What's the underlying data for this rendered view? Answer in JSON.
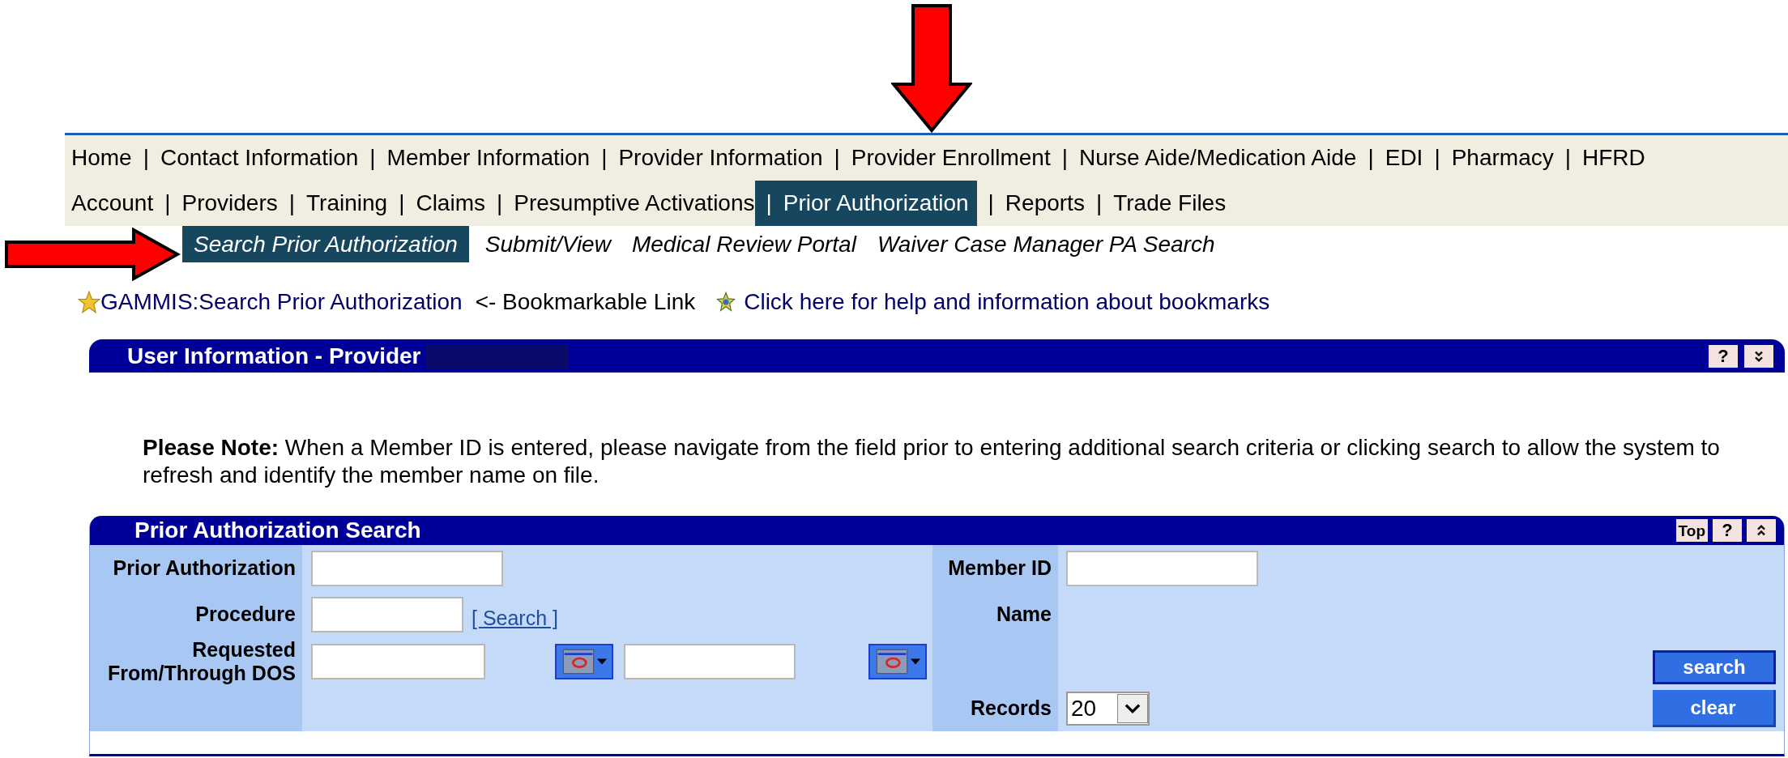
{
  "nav": {
    "items": [
      {
        "label": "Home",
        "selected": false
      },
      {
        "label": "Contact Information",
        "separator": "|",
        "selected": false
      },
      {
        "label": "Member Information",
        "separator": "|",
        "selected": false
      },
      {
        "label": "Provider Information",
        "separator": "|",
        "selected": false
      },
      {
        "label": "Provider Enrollment",
        "separator": "|",
        "selected": false
      },
      {
        "label": "Nurse Aide/Medication Aide",
        "separator": "|",
        "selected": false
      },
      {
        "label": "EDI",
        "separator": "|",
        "selected": false
      },
      {
        "label": "Pharmacy",
        "separator": "|",
        "selected": false
      },
      {
        "label": "HFRD",
        "separator": "|",
        "selected": false
      },
      {
        "label": "Account",
        "selected": false
      },
      {
        "label": "Providers",
        "separator": "|",
        "selected": false
      },
      {
        "label": "Training",
        "separator": "|",
        "selected": false
      },
      {
        "label": "Claims",
        "separator": "|",
        "selected": false
      },
      {
        "label": "Presumptive Activations",
        "separator": "|",
        "selected": false
      },
      {
        "label": "Prior Authorization",
        "separator": "|",
        "selected": true
      },
      {
        "label": "Reports",
        "separator": "|",
        "selected": false
      },
      {
        "label": "Trade Files",
        "separator": "|",
        "selected": false
      }
    ]
  },
  "submenu": [
    {
      "label": "Search Prior Authorization",
      "selected": true
    },
    {
      "label": "Submit/View",
      "selected": false
    },
    {
      "label": "Medical Review Portal",
      "selected": false
    },
    {
      "label": "Waiver Case Manager PA Search",
      "selected": false
    }
  ],
  "bookmark": {
    "link": "GAMMIS:Search Prior Authorization",
    "note": "<- Bookmarkable Link",
    "help_link": "Click here for help and information about bookmarks"
  },
  "user_info_panel": {
    "title": "User Information - Provider",
    "help_button": "?"
  },
  "notice": "**Please Note:** When a Member ID is entered, please navigate from the field prior to entering additional search criteria or clicking search to allow the system to refresh and identify the member name on file.",
  "search_panel": {
    "title": "Prior Authorization Search",
    "top_button": "Top",
    "help_button": "?",
    "prior_authorization_label": "Prior Authorization",
    "procedure_label": "Procedure",
    "procedure_search_link": "[ Search ]",
    "dos_label": [
      "Requested",
      "From/Through DOS"
    ],
    "member_id_label": "Member ID",
    "name_label": "Name",
    "records_label": "Records",
    "records_value": "20",
    "buttons": [
      "search",
      "clear"
    ]
  }
}
